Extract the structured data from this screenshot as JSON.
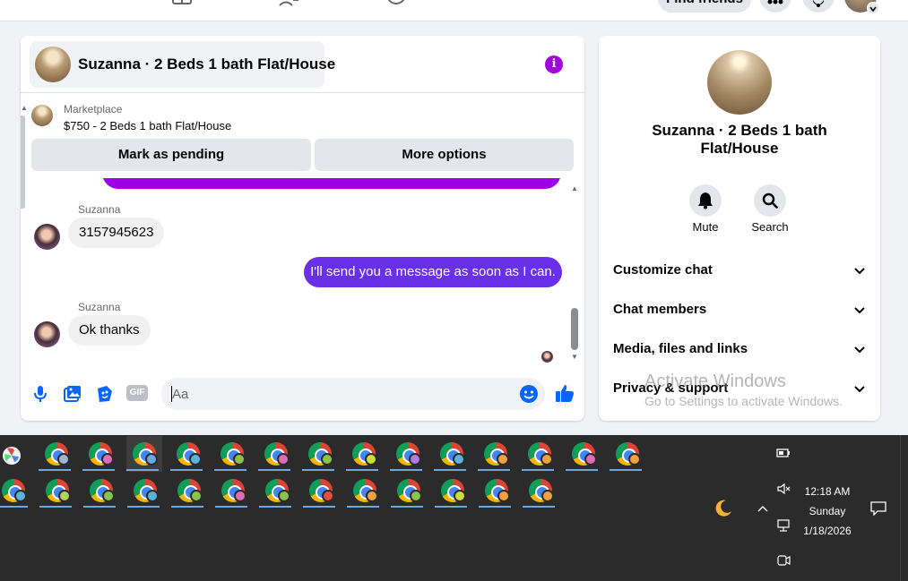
{
  "topnav": {
    "find_friends_label": "Find friends"
  },
  "chat": {
    "header_title": "Suzanna · 2 Beds 1 bath Flat/House",
    "info_symbol": "i",
    "marketplace": {
      "label": "Marketplace",
      "listing": "$750 - 2 Beds 1 bath Flat/House"
    },
    "actions": {
      "mark_pending": "Mark as pending",
      "more_options": "More options"
    },
    "messages": [
      {
        "sender": "Suzanna",
        "text": "3157945623",
        "direction": "incoming"
      },
      {
        "sender": "",
        "text": "I'll send you a message as soon as I can.",
        "direction": "outgoing"
      },
      {
        "sender": "Suzanna",
        "text": "Ok thanks",
        "direction": "incoming"
      }
    ],
    "composer": {
      "placeholder": "Aa",
      "gif_label": "GIF"
    },
    "colors": {
      "accent_purple": "#6a2fe8",
      "info_purple": "#a300e0",
      "link_blue": "#0866ff"
    }
  },
  "info_panel": {
    "name": "Suzanna · 2 Beds 1 bath Flat/House",
    "buttons": {
      "mute": "Mute",
      "search": "Search"
    },
    "sections": [
      "Customize chat",
      "Chat members",
      "Media, files and links",
      "Privacy & support"
    ]
  },
  "watermark": {
    "title": "Activate Windows",
    "subtitle": "Go to Settings to activate Windows."
  },
  "taskbar": {
    "row1_profile_colors": [
      "#9ab6d8",
      "#e06bb8",
      "#6aa9e6",
      "#5ab3d8",
      "#8bc34a",
      "#e06bb8",
      "#8bc34a",
      "#cddc39",
      "#b07be0",
      "#5ab3d8",
      "#f0a040",
      "#f0a040",
      "#e06bb8",
      "#f0a040"
    ],
    "row2_profile_colors": [
      "#5ab3d8",
      "#b0d060",
      "#8bc34a",
      "#5ab3d8",
      "#8bc34a",
      "#e06bb8",
      "#8bc34a",
      "#e74c3c",
      "#f0a040",
      "#8bc34a",
      "#cddc39",
      "#f0a040",
      "#f0a040"
    ],
    "clock": {
      "time": "12:18 AM",
      "day": "Sunday",
      "date": "1/18/2026"
    }
  }
}
